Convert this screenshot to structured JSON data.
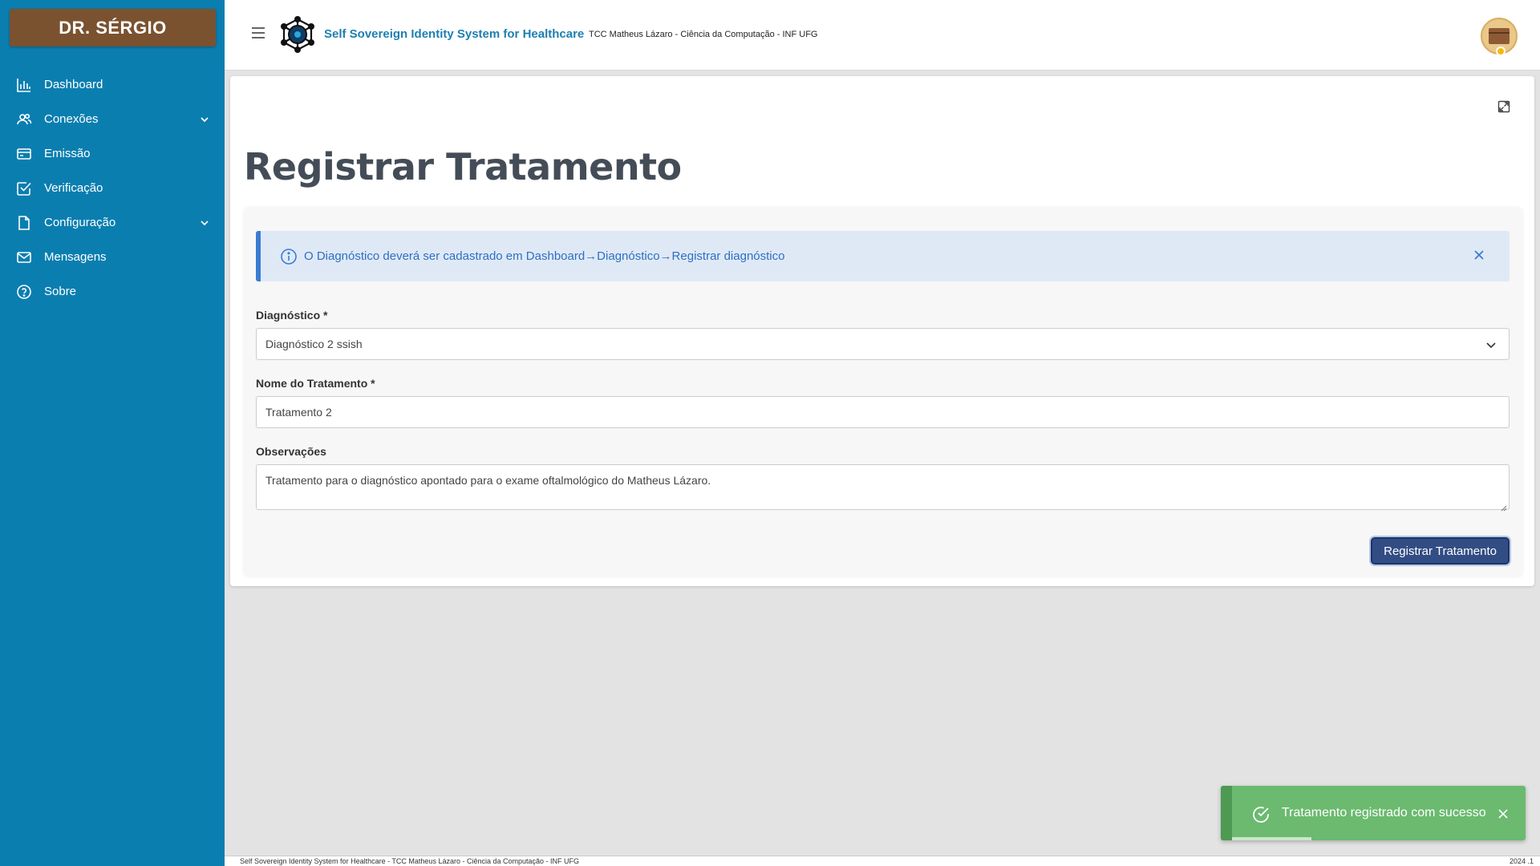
{
  "sidebar": {
    "brand": "DR. SÉRGIO",
    "items": [
      {
        "label": "Dashboard",
        "icon": "chart-bar-icon"
      },
      {
        "label": "Conexões",
        "icon": "users-icon",
        "expandable": true
      },
      {
        "label": "Emissão",
        "icon": "credit-card-icon"
      },
      {
        "label": "Verificação",
        "icon": "check-square-icon"
      },
      {
        "label": "Configuração",
        "icon": "file-icon",
        "expandable": true
      },
      {
        "label": "Mensagens",
        "icon": "mail-icon"
      },
      {
        "label": "Sobre",
        "icon": "help-circle-icon"
      }
    ],
    "color": "#0b7eb0"
  },
  "header": {
    "title": "Self Sovereign Identity System for Healthcare",
    "subtitle": "TCC Matheus Lázaro - Ciência da Computação - INF UFG"
  },
  "page": {
    "title": "Registrar Tratamento",
    "alert": "O Diagnóstico deverá ser cadastrado em Dashboard→Diagnóstico→Registrar diagnóstico",
    "fields": {
      "diagnostico_label": "Diagnóstico *",
      "diagnostico_value": "Diagnóstico 2 ssish",
      "nome_label": "Nome do Tratamento *",
      "nome_value": "Tratamento 2",
      "obs_label": "Observações",
      "obs_value": "Tratamento para o diagnóstico apontado para o exame oftalmológico do Matheus Lázaro."
    },
    "submit_label": "Registrar Tratamento"
  },
  "toast": {
    "message": "Tratamento registrado com sucesso",
    "progress": 0.27,
    "color": "#6bba6f"
  },
  "footer": {
    "left": "Self Sovereign Identity System for Healthcare - TCC Matheus Lázaro - Ciência da Computação - INF UFG",
    "right": "2024 .1"
  }
}
